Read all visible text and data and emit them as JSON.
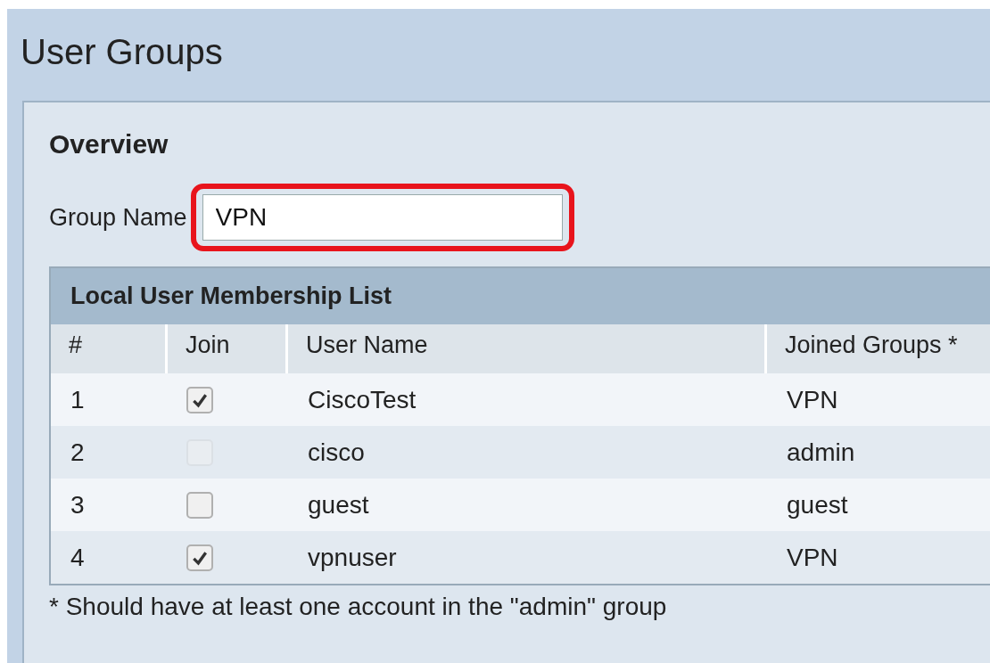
{
  "page": {
    "title": "User Groups"
  },
  "overview": {
    "heading": "Overview",
    "group_name": {
      "label": "Group Name",
      "value": "VPN"
    }
  },
  "membership": {
    "title": "Local User Membership List",
    "columns": [
      "#",
      "Join",
      "User Name",
      "Joined Groups *"
    ],
    "rows": [
      {
        "number": "1",
        "join": {
          "checked": true,
          "disabled": false
        },
        "user": "CiscoTest",
        "groups": "VPN"
      },
      {
        "number": "2",
        "join": {
          "checked": false,
          "disabled": true
        },
        "user": "cisco",
        "groups": "admin"
      },
      {
        "number": "3",
        "join": {
          "checked": false,
          "disabled": false
        },
        "user": "guest",
        "groups": "guest"
      },
      {
        "number": "4",
        "join": {
          "checked": true,
          "disabled": false
        },
        "user": "vpnuser",
        "groups": "VPN"
      }
    ],
    "note": "* Should have at least one account in the \"admin\" group"
  }
}
